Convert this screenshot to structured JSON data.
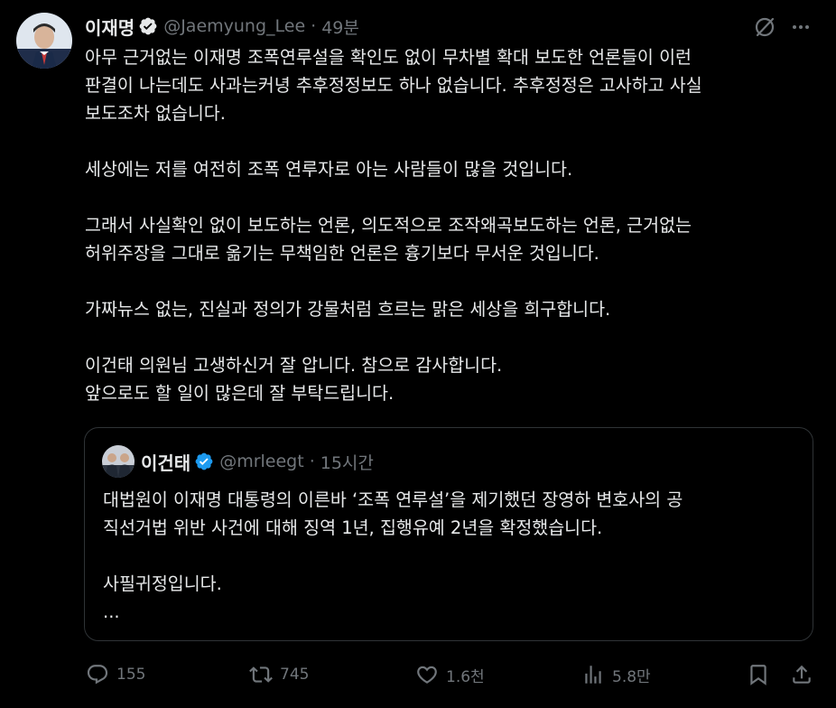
{
  "tweet": {
    "author": {
      "display_name": "이재명",
      "handle": "@Jaemyung_Lee",
      "time": "49분"
    },
    "body": [
      "아무 근거없는 이재명 조폭연루설을 확인도 없이 무차별 확대 보도한 언론들이 이런",
      "판결이 나는데도 사과는커녕 추후정정보도 하나 없습니다. 추후정정은 고사하고 사실",
      "보도조차 없습니다.",
      "",
      "세상에는 저를 여전히 조폭 연루자로 아는 사람들이 많을 것입니다.",
      "",
      "그래서 사실확인 없이 보도하는 언론, 의도적으로 조작왜곡보도하는 언론, 근거없는",
      "허위주장을 그대로 옮기는 무책임한 언론은 흉기보다 무서운 것입니다.",
      "",
      "가짜뉴스 없는, 진실과 정의가 강물처럼 흐르는 맑은 세상을 희구합니다.",
      "",
      "이건태 의원님 고생하신거 잘 압니다. 참으로 감사합니다.",
      "앞으로도 할 일이 많은데 잘 부탁드립니다."
    ]
  },
  "quote": {
    "author": {
      "display_name": "이건태",
      "handle": "@mrleegt",
      "time": "15시간"
    },
    "body": [
      "대법원이 이재명 대통령의 이른바 ‘조폭 연루설’을 제기했던 장영하 변호사의 공",
      "직선거법 위반 사건에 대해 징역 1년, 집행유예 2년을 확정했습니다.",
      "",
      "사필귀정입니다.",
      "..."
    ]
  },
  "actions": {
    "replies": "155",
    "reposts": "745",
    "likes": "1.6천",
    "views": "5.8만"
  },
  "header": {
    "separator": "·"
  },
  "colors": {
    "background": "#000000",
    "text": "#e7e9ea",
    "muted": "#71767b",
    "verified": "#1d9bf0",
    "border": "#2f3336"
  }
}
